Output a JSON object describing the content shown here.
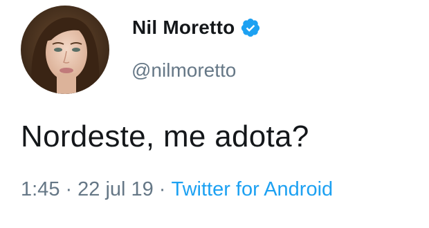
{
  "user": {
    "display_name": "Nil Moretto",
    "handle": "@nilmoretto",
    "verified": true,
    "verified_icon": "verified-badge-icon",
    "verified_color": "#1da1f2"
  },
  "tweet": {
    "text": "Nordeste, me adota?",
    "time": "1:45",
    "separator": "·",
    "date": "22 jul 19",
    "source": "Twitter for Android"
  },
  "colors": {
    "name": "#14171a",
    "muted": "#657786",
    "link": "#1da1f2"
  }
}
